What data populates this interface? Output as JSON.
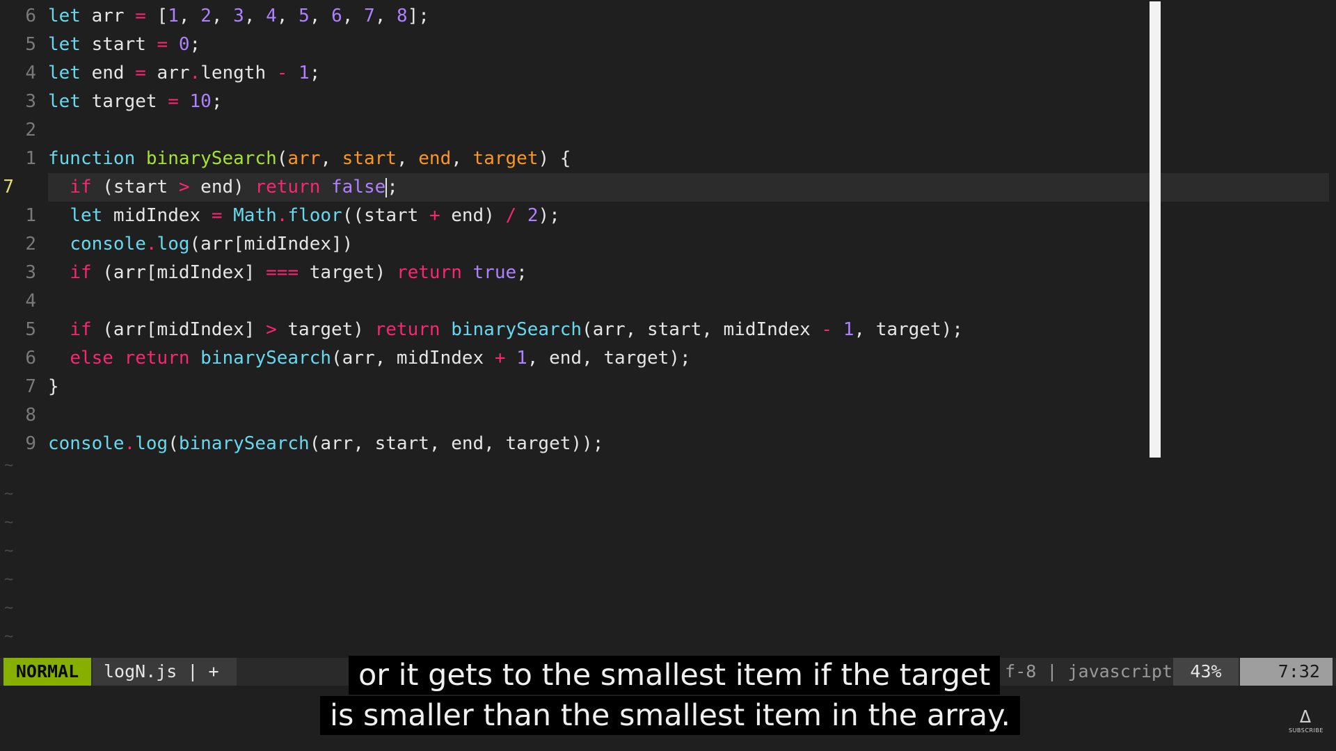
{
  "editor": {
    "lines": [
      {
        "num": "6",
        "tokens": [
          [
            "kw",
            "let"
          ],
          [
            "pl",
            " arr "
          ],
          [
            "op",
            "="
          ],
          [
            "pl",
            " ["
          ],
          [
            "num",
            "1"
          ],
          [
            "pl",
            ", "
          ],
          [
            "num",
            "2"
          ],
          [
            "pl",
            ", "
          ],
          [
            "num",
            "3"
          ],
          [
            "pl",
            ", "
          ],
          [
            "num",
            "4"
          ],
          [
            "pl",
            ", "
          ],
          [
            "num",
            "5"
          ],
          [
            "pl",
            ", "
          ],
          [
            "num",
            "6"
          ],
          [
            "pl",
            ", "
          ],
          [
            "num",
            "7"
          ],
          [
            "pl",
            ", "
          ],
          [
            "num",
            "8"
          ],
          [
            "pl",
            "];"
          ]
        ]
      },
      {
        "num": "5",
        "tokens": [
          [
            "kw",
            "let"
          ],
          [
            "pl",
            " start "
          ],
          [
            "op",
            "="
          ],
          [
            "pl",
            " "
          ],
          [
            "num",
            "0"
          ],
          [
            "pl",
            ";"
          ]
        ]
      },
      {
        "num": "4",
        "tokens": [
          [
            "kw",
            "let"
          ],
          [
            "pl",
            " end "
          ],
          [
            "op",
            "="
          ],
          [
            "pl",
            " arr"
          ],
          [
            "op",
            "."
          ],
          [
            "pl",
            "length "
          ],
          [
            "op",
            "-"
          ],
          [
            "pl",
            " "
          ],
          [
            "num",
            "1"
          ],
          [
            "pl",
            ";"
          ]
        ]
      },
      {
        "num": "3",
        "tokens": [
          [
            "kw",
            "let"
          ],
          [
            "pl",
            " target "
          ],
          [
            "op",
            "="
          ],
          [
            "pl",
            " "
          ],
          [
            "num",
            "10"
          ],
          [
            "pl",
            ";"
          ]
        ]
      },
      {
        "num": "2",
        "tokens": []
      },
      {
        "num": "1",
        "tokens": [
          [
            "kw",
            "function"
          ],
          [
            "pl",
            " "
          ],
          [
            "fn",
            "binarySearch"
          ],
          [
            "pl",
            "("
          ],
          [
            "par",
            "arr"
          ],
          [
            "pl",
            ", "
          ],
          [
            "par",
            "start"
          ],
          [
            "pl",
            ", "
          ],
          [
            "par",
            "end"
          ],
          [
            "pl",
            ", "
          ],
          [
            "par",
            "target"
          ],
          [
            "pl",
            ") {"
          ]
        ]
      },
      {
        "num": "7",
        "current": true,
        "tokens": [
          [
            "pl",
            "  "
          ],
          [
            "ctl",
            "if"
          ],
          [
            "pl",
            " (start "
          ],
          [
            "op",
            ">"
          ],
          [
            "pl",
            " end) "
          ],
          [
            "ctl",
            "return"
          ],
          [
            "pl",
            " "
          ],
          [
            "num",
            "false"
          ],
          [
            "caret",
            ""
          ],
          [
            "pl",
            ";"
          ]
        ]
      },
      {
        "num": "1",
        "tokens": [
          [
            "pl",
            "  "
          ],
          [
            "kw",
            "let"
          ],
          [
            "pl",
            " midIndex "
          ],
          [
            "op",
            "="
          ],
          [
            "pl",
            " "
          ],
          [
            "cl",
            "Math"
          ],
          [
            "op",
            "."
          ],
          [
            "cl",
            "floor"
          ],
          [
            "pl",
            "((start "
          ],
          [
            "op",
            "+"
          ],
          [
            "pl",
            " end) "
          ],
          [
            "op",
            "/"
          ],
          [
            "pl",
            " "
          ],
          [
            "num",
            "2"
          ],
          [
            "pl",
            ");"
          ]
        ]
      },
      {
        "num": "2",
        "tokens": [
          [
            "pl",
            "  "
          ],
          [
            "cl",
            "console"
          ],
          [
            "op",
            "."
          ],
          [
            "cl",
            "log"
          ],
          [
            "pl",
            "(arr[midIndex])"
          ]
        ]
      },
      {
        "num": "3",
        "tokens": [
          [
            "pl",
            "  "
          ],
          [
            "ctl",
            "if"
          ],
          [
            "pl",
            " (arr[midIndex] "
          ],
          [
            "op",
            "==="
          ],
          [
            "pl",
            " target) "
          ],
          [
            "ctl",
            "return"
          ],
          [
            "pl",
            " "
          ],
          [
            "num",
            "true"
          ],
          [
            "pl",
            ";"
          ]
        ]
      },
      {
        "num": "4",
        "tokens": []
      },
      {
        "num": "5",
        "tokens": [
          [
            "pl",
            "  "
          ],
          [
            "ctl",
            "if"
          ],
          [
            "pl",
            " (arr[midIndex] "
          ],
          [
            "op",
            ">"
          ],
          [
            "pl",
            " target) "
          ],
          [
            "ctl",
            "return"
          ],
          [
            "pl",
            " "
          ],
          [
            "cl",
            "binarySearch"
          ],
          [
            "pl",
            "(arr, start, midIndex "
          ],
          [
            "op",
            "-"
          ],
          [
            "pl",
            " "
          ],
          [
            "num",
            "1"
          ],
          [
            "pl",
            ", target);"
          ]
        ]
      },
      {
        "num": "6",
        "tokens": [
          [
            "pl",
            "  "
          ],
          [
            "ctl",
            "else"
          ],
          [
            "pl",
            " "
          ],
          [
            "ctl",
            "return"
          ],
          [
            "pl",
            " "
          ],
          [
            "cl",
            "binarySearch"
          ],
          [
            "pl",
            "(arr, midIndex "
          ],
          [
            "op",
            "+"
          ],
          [
            "pl",
            " "
          ],
          [
            "num",
            "1"
          ],
          [
            "pl",
            ", end, target);"
          ]
        ]
      },
      {
        "num": "7",
        "tokens": [
          [
            "pl",
            "}"
          ]
        ]
      },
      {
        "num": "8",
        "tokens": []
      },
      {
        "num": "9",
        "tokens": [
          [
            "cl",
            "console"
          ],
          [
            "op",
            "."
          ],
          [
            "cl",
            "log"
          ],
          [
            "pl",
            "("
          ],
          [
            "cl",
            "binarySearch"
          ],
          [
            "pl",
            "(arr, start, end, target));"
          ]
        ]
      }
    ],
    "empty_line_marker": "~",
    "empty_line_count": 7
  },
  "statusline": {
    "mode": "NORMAL",
    "file": "logN.js | +",
    "encoding_info": "f-8 | javascript",
    "percent": "43%",
    "position": "7:32"
  },
  "captions": {
    "line1": "or it gets to the smallest item if the target",
    "line2": "is smaller than the smallest item in the array."
  },
  "logo": {
    "icon": "flame-icon",
    "label": "SUBSCRIBE"
  }
}
